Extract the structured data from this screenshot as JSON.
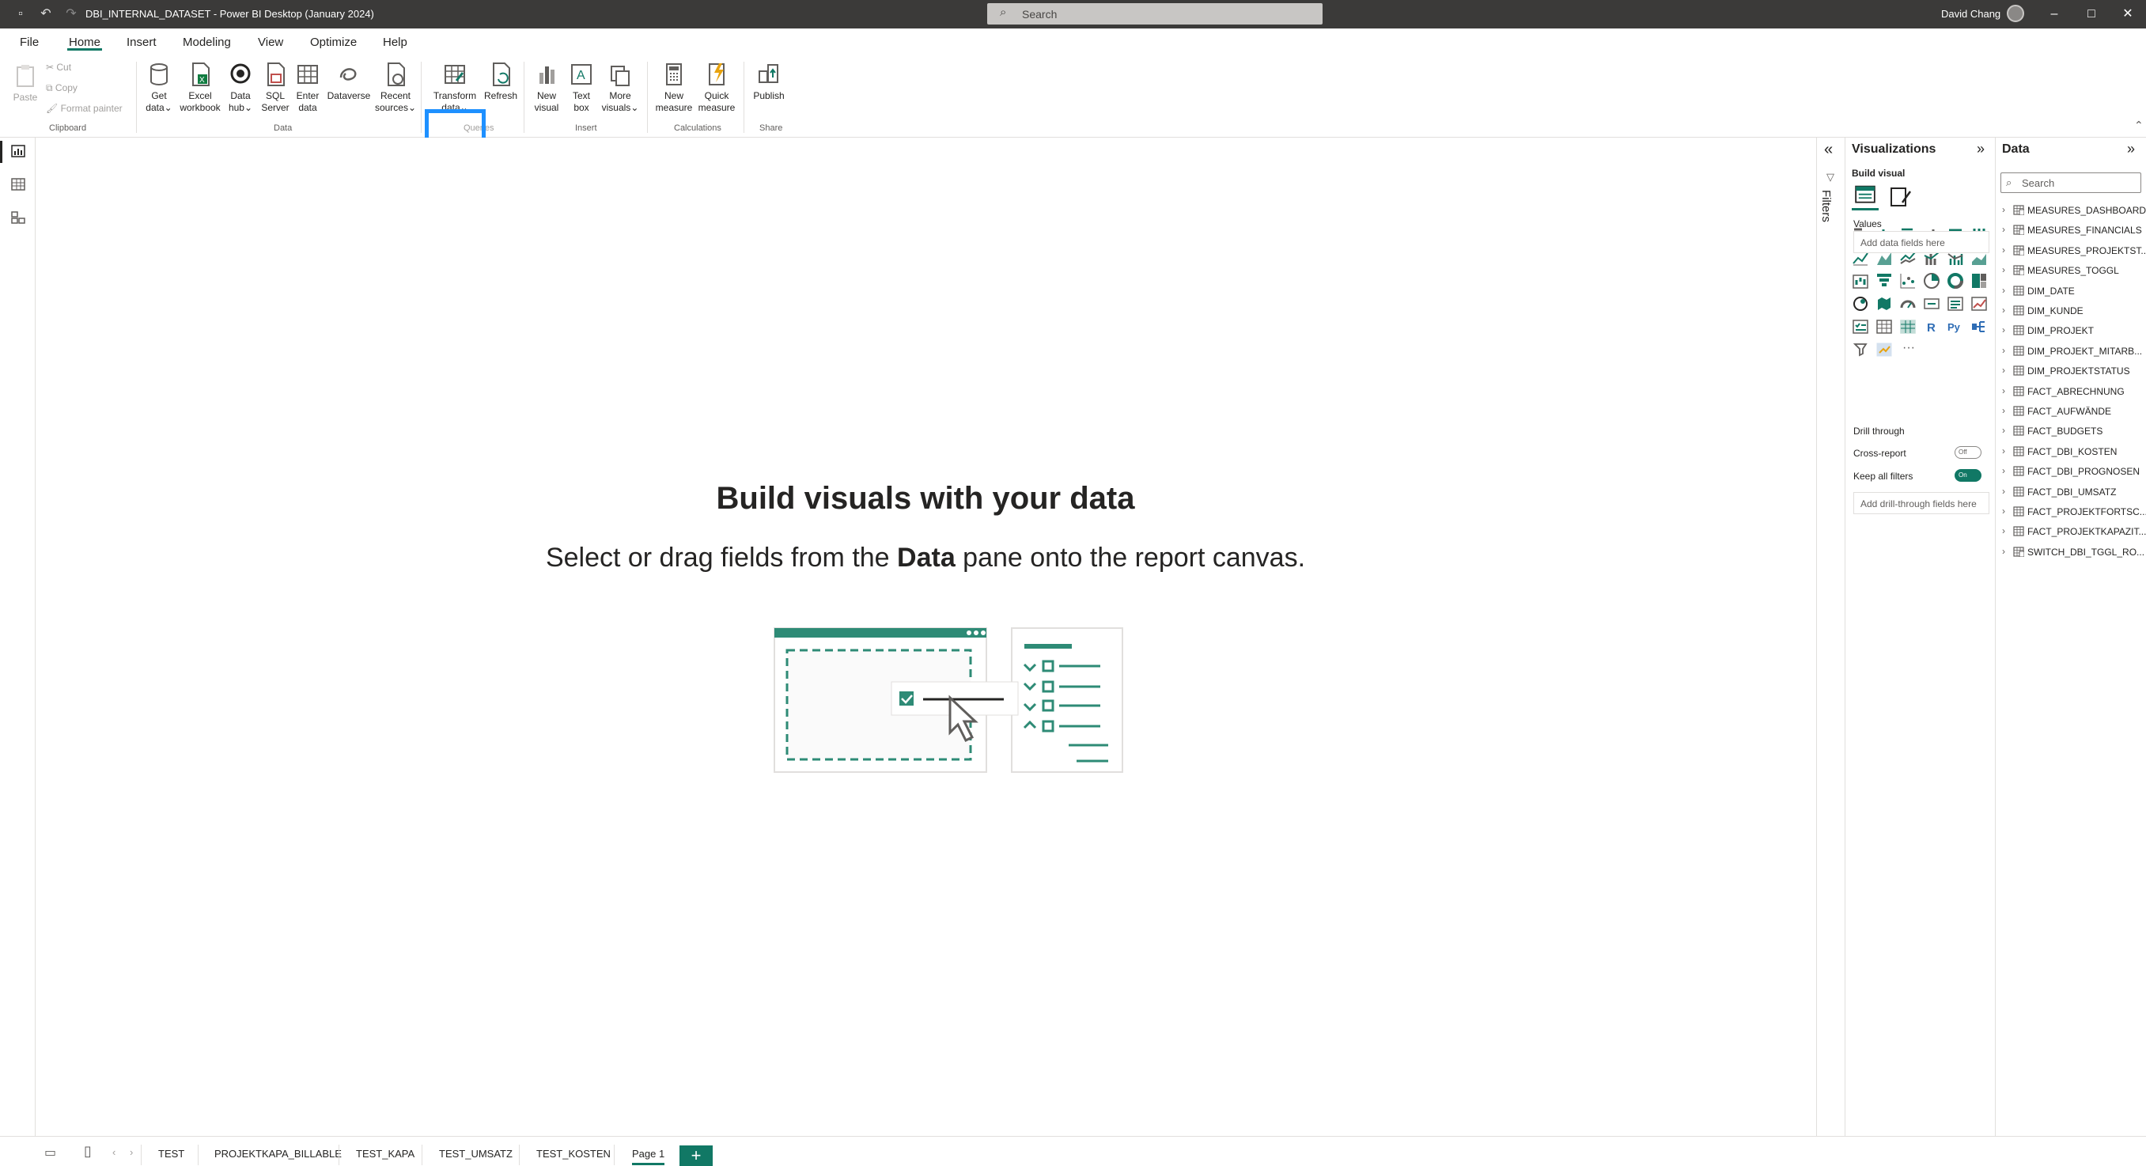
{
  "titlebar": {
    "title": "DBI_INTERNAL_DATASET - Power BI Desktop (January 2024)",
    "search_placeholder": "Search",
    "user": "David Chang"
  },
  "menu": {
    "tabs": [
      "File",
      "Home",
      "Insert",
      "Modeling",
      "View",
      "Optimize",
      "Help"
    ],
    "active": "Home"
  },
  "ribbon": {
    "clipboard": {
      "paste": "Paste",
      "cut": "Cut",
      "copy": "Copy",
      "format_painter": "Format painter",
      "group": "Clipboard"
    },
    "data": {
      "get_data": [
        "Get",
        "data"
      ],
      "excel": [
        "Excel",
        "workbook"
      ],
      "data_hub": [
        "Data",
        "hub"
      ],
      "sql": [
        "SQL",
        "Server"
      ],
      "enter": [
        "Enter",
        "data"
      ],
      "dataverse": "Dataverse",
      "recent": [
        "Recent",
        "sources"
      ],
      "group": "Data"
    },
    "queries": {
      "transform": [
        "Transform",
        "data"
      ],
      "refresh": "Refresh",
      "group": "Queries"
    },
    "insert": {
      "new_visual": [
        "New",
        "visual"
      ],
      "text_box": [
        "Text",
        "box"
      ],
      "more_visuals": [
        "More",
        "visuals"
      ],
      "group": "Insert"
    },
    "calculations": {
      "new_measure": [
        "New",
        "measure"
      ],
      "quick_measure": [
        "Quick",
        "measure"
      ],
      "group": "Calculations"
    },
    "share": {
      "publish": "Publish",
      "group": "Share"
    }
  },
  "canvas": {
    "heading": "Build visuals with your data",
    "sub_prefix": "Select or drag fields from the ",
    "sub_bold": "Data",
    "sub_suffix": " pane onto the report canvas."
  },
  "filters": {
    "label": "Filters"
  },
  "visualizations": {
    "title": "Visualizations",
    "build_visual": "Build visual",
    "values_label": "Values",
    "values_placeholder": "Add data fields here",
    "drill_through": "Drill through",
    "cross_report": "Cross-report",
    "cross_report_state": "Off",
    "keep_all_filters": "Keep all filters",
    "keep_all_filters_state": "On",
    "drill_placeholder": "Add drill-through fields here",
    "more": "···"
  },
  "data_pane": {
    "title": "Data",
    "search_placeholder": "Search",
    "tables": [
      {
        "name": "MEASURES_DASHBOARD",
        "kind": "measure"
      },
      {
        "name": "MEASURES_FINANCIALS",
        "kind": "measure"
      },
      {
        "name": "MEASURES_PROJEKTST...",
        "kind": "measure"
      },
      {
        "name": "MEASURES_TOGGL",
        "kind": "measure"
      },
      {
        "name": "DIM_DATE",
        "kind": "table"
      },
      {
        "name": "DIM_KUNDE",
        "kind": "table"
      },
      {
        "name": "DIM_PROJEKT",
        "kind": "table"
      },
      {
        "name": "DIM_PROJEKT_MITARB...",
        "kind": "table"
      },
      {
        "name": "DIM_PROJEKTSTATUS",
        "kind": "table"
      },
      {
        "name": "FACT_ABRECHNUNG",
        "kind": "table"
      },
      {
        "name": "FACT_AUFWÄNDE",
        "kind": "table"
      },
      {
        "name": "FACT_BUDGETS",
        "kind": "table"
      },
      {
        "name": "FACT_DBI_KOSTEN",
        "kind": "table"
      },
      {
        "name": "FACT_DBI_PROGNOSEN",
        "kind": "table"
      },
      {
        "name": "FACT_DBI_UMSATZ",
        "kind": "table"
      },
      {
        "name": "FACT_PROJEKTFORTSC...",
        "kind": "table"
      },
      {
        "name": "FACT_PROJEKTKAPAZIT...",
        "kind": "table"
      },
      {
        "name": "SWITCH_DBI_TGGL_RO...",
        "kind": "measure"
      }
    ]
  },
  "pages": {
    "tabs": [
      "TEST",
      "PROJEKTKAPA_BILLABLE",
      "TEST_KAPA",
      "TEST_UMSATZ",
      "TEST_KOSTEN",
      "Page 1"
    ],
    "active": "Page 1",
    "add": "+"
  },
  "colors": {
    "accent": "#117865",
    "highlight": "#1e90ff",
    "titlebar": "#3b3a39"
  }
}
